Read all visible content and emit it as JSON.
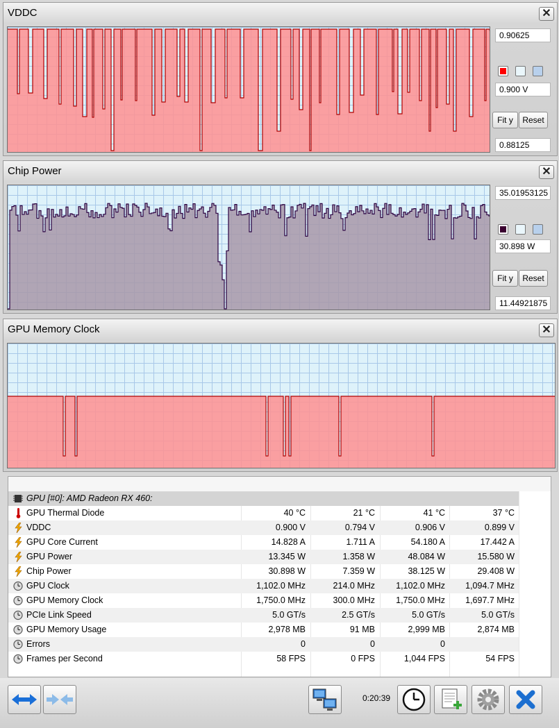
{
  "graphs": [
    {
      "title": "VDDC",
      "max_label": "0.90625",
      "current_label": "0.900 V",
      "min_label": "0.88125",
      "fit_label": "Fit y",
      "reset_label": "Reset",
      "series_color": "#ff0000"
    },
    {
      "title": "Chip Power",
      "max_label": "35.01953125",
      "current_label": "30.898 W",
      "min_label": "11.44921875",
      "fit_label": "Fit y",
      "reset_label": "Reset",
      "series_color": "#3a0030"
    },
    {
      "title": "GPU Memory Clock"
    }
  ],
  "sensor_table": {
    "device": "GPU [#0]: AMD Radeon RX 460:",
    "rows": [
      {
        "name": "GPU Thermal Diode",
        "icon": "thermometer-icon",
        "values": [
          "40 °C",
          "21 °C",
          "41 °C",
          "37 °C"
        ]
      },
      {
        "name": "VDDC",
        "icon": "lightning-icon",
        "values": [
          "0.900 V",
          "0.794 V",
          "0.906 V",
          "0.899 V"
        ]
      },
      {
        "name": "GPU Core Current",
        "icon": "lightning-icon",
        "values": [
          "14.828 A",
          "1.711 A",
          "54.180 A",
          "17.442 A"
        ]
      },
      {
        "name": "GPU Power",
        "icon": "lightning-icon",
        "values": [
          "13.345 W",
          "1.358 W",
          "48.084 W",
          "15.580 W"
        ]
      },
      {
        "name": "Chip Power",
        "icon": "lightning-icon",
        "values": [
          "30.898 W",
          "7.359 W",
          "38.125 W",
          "29.408 W"
        ]
      },
      {
        "name": "GPU Clock",
        "icon": "clock-icon",
        "values": [
          "1,102.0 MHz",
          "214.0 MHz",
          "1,102.0 MHz",
          "1,094.7 MHz"
        ]
      },
      {
        "name": "GPU Memory Clock",
        "icon": "clock-icon",
        "values": [
          "1,750.0 MHz",
          "300.0 MHz",
          "1,750.0 MHz",
          "1,697.7 MHz"
        ]
      },
      {
        "name": "PCIe Link Speed",
        "icon": "clock-icon",
        "values": [
          "5.0 GT/s",
          "2.5 GT/s",
          "5.0 GT/s",
          "5.0 GT/s"
        ]
      },
      {
        "name": "GPU Memory Usage",
        "icon": "clock-icon",
        "values": [
          "2,978 MB",
          "91 MB",
          "2,999 MB",
          "2,874 MB"
        ]
      },
      {
        "name": "Errors",
        "icon": "clock-icon",
        "values": [
          "0",
          "0",
          "0",
          ""
        ]
      },
      {
        "name": "Frames per Second",
        "icon": "clock-icon",
        "values": [
          "58 FPS",
          "0 FPS",
          "1,044 FPS",
          "54 FPS"
        ]
      }
    ]
  },
  "toolbar": {
    "timer": "0:20:39"
  },
  "colors": {
    "fill_red": "#ff9090",
    "fill_purple": "#a898a8",
    "plot_bg": "#def2fa",
    "grid": "#a8c8e8"
  }
}
